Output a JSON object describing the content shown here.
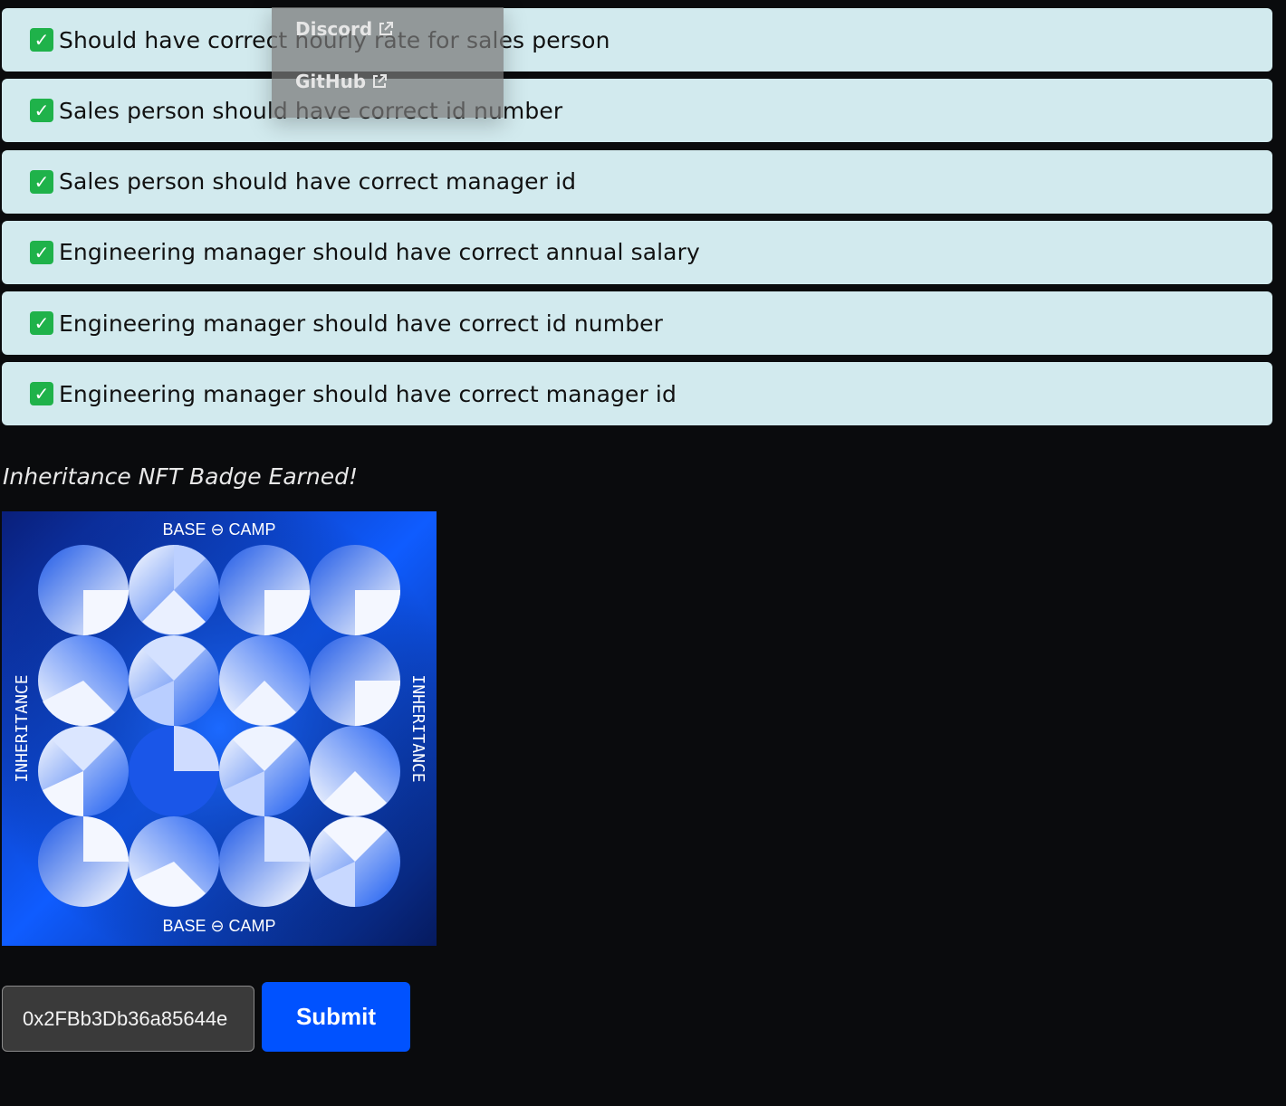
{
  "results": [
    {
      "label": "Should have correct hourly rate for sales person",
      "status_icon": "check-icon"
    },
    {
      "label": "Sales person should have correct id number",
      "status_icon": "check-icon"
    },
    {
      "label": "Sales person should have correct manager id",
      "status_icon": "check-icon"
    },
    {
      "label": "Engineering manager should have correct annual salary",
      "status_icon": "check-icon"
    },
    {
      "label": "Engineering manager should have correct id number",
      "status_icon": "check-icon"
    },
    {
      "label": "Engineering manager should have correct manager id",
      "status_icon": "check-icon"
    }
  ],
  "check_glyph": "✓",
  "badge": {
    "heading": "Inheritance NFT Badge Earned!",
    "image": {
      "top_text": "BASE ⊖ CAMP",
      "bottom_text": "BASE ⊖ CAMP",
      "side_text": "INHERITANCE",
      "background_colors": [
        "#0a1f7a",
        "#0f5cff",
        "#061a5e"
      ]
    }
  },
  "form": {
    "address_value": "0x2FBb3Db36a85644e",
    "submit_label": "Submit"
  },
  "nav_dropdown": {
    "items": [
      {
        "label": "Discord",
        "icon": "external-link-icon"
      },
      {
        "label": "GitHub",
        "icon": "external-link-icon"
      }
    ]
  },
  "colors": {
    "page_background": "#0a0b0d",
    "result_background": "#d2eaee",
    "success": "#1fb24a",
    "accent": "#0052ff"
  }
}
